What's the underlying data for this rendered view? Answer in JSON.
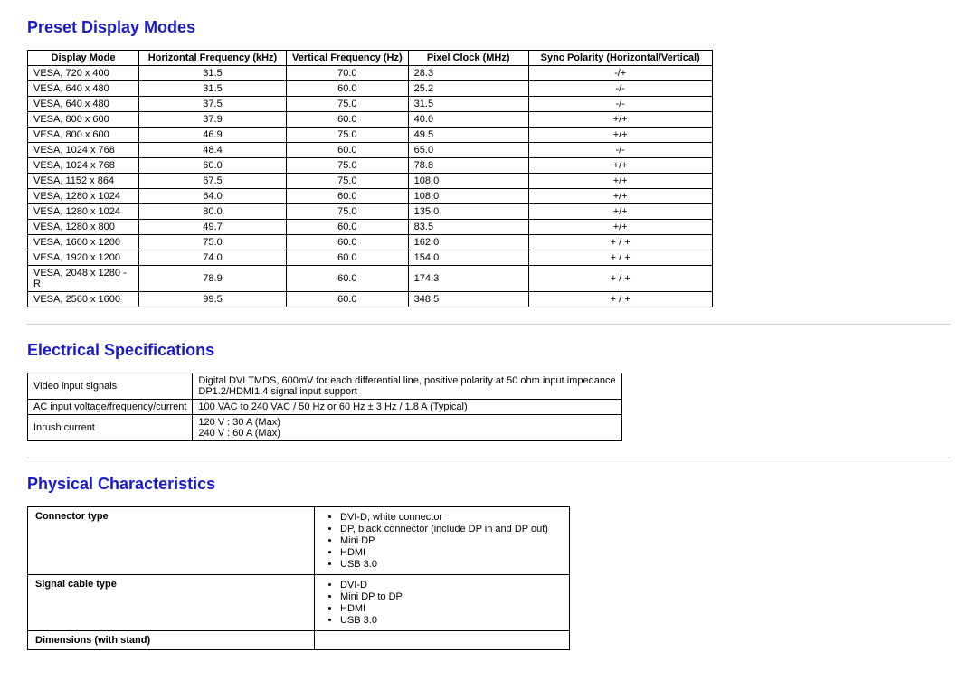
{
  "section1": {
    "title": "Preset Display Modes",
    "headers": [
      "Display Mode",
      "Horizontal Frequency (kHz)",
      "Vertical Frequency (Hz)",
      "Pixel Clock (MHz)",
      "Sync Polarity (Horizontal/Vertical)"
    ],
    "rows": [
      {
        "mode": "VESA, 720 x 400",
        "hf": "31.5",
        "vf": "70.0",
        "pc": "28.3",
        "sp": "-/+"
      },
      {
        "mode": "VESA, 640 x 480",
        "hf": "31.5",
        "vf": "60.0",
        "pc": "25.2",
        "sp": "-/-"
      },
      {
        "mode": "VESA, 640 x 480",
        "hf": "37.5",
        "vf": "75.0",
        "pc": "31.5",
        "sp": "-/-"
      },
      {
        "mode": "VESA, 800 x 600",
        "hf": "37.9",
        "vf": "60.0",
        "pc": "40.0",
        "sp": "+/+"
      },
      {
        "mode": "VESA, 800 x 600",
        "hf": "46.9",
        "vf": "75.0",
        "pc": "49.5",
        "sp": "+/+"
      },
      {
        "mode": "VESA, 1024 x 768",
        "hf": "48.4",
        "vf": "60.0",
        "pc": "65.0",
        "sp": "-/-"
      },
      {
        "mode": "VESA, 1024 x 768",
        "hf": "60.0",
        "vf": "75.0",
        "pc": "78.8",
        "sp": "+/+"
      },
      {
        "mode": "VESA, 1152 x 864",
        "hf": "67.5",
        "vf": "75.0",
        "pc": "108.0",
        "sp": "+/+"
      },
      {
        "mode": "VESA, 1280 x 1024",
        "hf": "64.0",
        "vf": "60.0",
        "pc": "108.0",
        "sp": "+/+"
      },
      {
        "mode": "VESA, 1280 x 1024",
        "hf": "80.0",
        "vf": "75.0",
        "pc": "135.0",
        "sp": "+/+"
      },
      {
        "mode": "VESA, 1280 x 800",
        "hf": "49.7",
        "vf": "60.0",
        "pc": "83.5",
        "sp": "+/+"
      },
      {
        "mode": "VESA, 1600 x 1200",
        "hf": "75.0",
        "vf": "60.0",
        "pc": "162.0",
        "sp": "+ / +"
      },
      {
        "mode": "VESA, 1920 x 1200",
        "hf": "74.0",
        "vf": "60.0",
        "pc": "154.0",
        "sp": "+ / +"
      },
      {
        "mode": "VESA, 2048 x 1280 - R",
        "hf": "78.9",
        "vf": "60.0",
        "pc": "174.3",
        "sp": "+ / +"
      },
      {
        "mode": "VESA, 2560 x 1600",
        "hf": "99.5",
        "vf": "60.0",
        "pc": "348.5",
        "sp": "+ / +"
      }
    ]
  },
  "section2": {
    "title": "Electrical Specifications",
    "rows": [
      {
        "label": "Video input signals",
        "value": "Digital DVI TMDS, 600mV for each differential line, positive polarity at 50 ohm input impedance\nDP1.2/HDMI1.4 signal input support"
      },
      {
        "label": "AC input voltage/frequency/current",
        "value": "100 VAC to 240 VAC / 50 Hz or 60 Hz ± 3 Hz / 1.8 A (Typical)"
      },
      {
        "label": "Inrush current",
        "value": "120 V : 30 A (Max)\n240 V : 60 A (Max)"
      }
    ]
  },
  "section3": {
    "title": "Physical Characteristics",
    "rows": [
      {
        "label": "Connector type",
        "items": [
          "DVI-D, white connector",
          "DP, black connector (include DP in and DP out)",
          "Mini DP",
          "HDMI",
          "USB 3.0"
        ]
      },
      {
        "label": "Signal cable type",
        "items": [
          "DVI-D",
          "Mini DP to DP",
          "HDMI",
          "USB 3.0"
        ]
      },
      {
        "label": "Dimensions (with stand)",
        "items": []
      }
    ]
  }
}
